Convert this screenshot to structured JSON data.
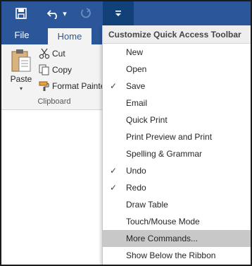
{
  "quick_access": {
    "save_icon": "save-icon",
    "undo_icon": "undo-icon",
    "redo_icon": "redo-icon",
    "customize_icon": "customize-dropdown-icon"
  },
  "tabs": {
    "file": "File",
    "home": "Home"
  },
  "clipboard": {
    "paste": "Paste",
    "cut": "Cut",
    "copy": "Copy",
    "format_painter": "Format Painte",
    "group_label": "Clipboard"
  },
  "menu": {
    "header": "Customize Quick Access Toolbar",
    "items": [
      {
        "label": "New",
        "checked": false
      },
      {
        "label": "Open",
        "checked": false
      },
      {
        "label": "Save",
        "checked": true
      },
      {
        "label": "Email",
        "checked": false
      },
      {
        "label": "Quick Print",
        "checked": false
      },
      {
        "label": "Print Preview and Print",
        "checked": false
      },
      {
        "label": "Spelling & Grammar",
        "checked": false
      },
      {
        "label": "Undo",
        "checked": true
      },
      {
        "label": "Redo",
        "checked": true
      },
      {
        "label": "Draw Table",
        "checked": false
      },
      {
        "label": "Touch/Mouse Mode",
        "checked": false
      },
      {
        "label": "More Commands...",
        "checked": false,
        "highlighted": true
      },
      {
        "label": "Show Below the Ribbon",
        "checked": false
      }
    ],
    "check_glyph": "✓"
  },
  "colors": {
    "title_bar": "#2b579a",
    "ribbon": "#f3f3f3",
    "menu_hover": "#c8c8c8"
  }
}
